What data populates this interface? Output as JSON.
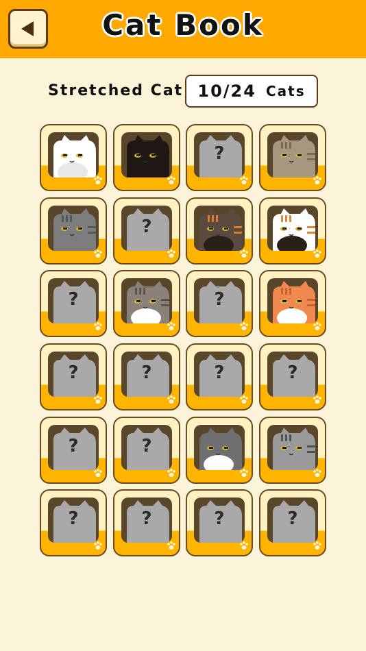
{
  "header": {
    "title": "Cat Book",
    "back_icon": "back-arrow-icon"
  },
  "collection": {
    "label": "Stretched Cat",
    "count": "10/24",
    "unit": "Cats"
  },
  "colors": {
    "header": "#ffa800",
    "background": "#fcf4d9",
    "card_bottom": "#ffb400",
    "card_top": "#fff2c2"
  },
  "cats": [
    {
      "unlocked": true,
      "fur": "white"
    },
    {
      "unlocked": true,
      "fur": "black"
    },
    {
      "unlocked": false,
      "label": "?"
    },
    {
      "unlocked": true,
      "fur": "brown-tabby"
    },
    {
      "unlocked": true,
      "fur": "gray-tabby"
    },
    {
      "unlocked": false,
      "label": "?"
    },
    {
      "unlocked": true,
      "fur": "tortoiseshell"
    },
    {
      "unlocked": true,
      "fur": "calico"
    },
    {
      "unlocked": false,
      "label": "?"
    },
    {
      "unlocked": true,
      "fur": "gray-white-tabby"
    },
    {
      "unlocked": false,
      "label": "?"
    },
    {
      "unlocked": true,
      "fur": "orange-tabby"
    },
    {
      "unlocked": false,
      "label": "?"
    },
    {
      "unlocked": false,
      "label": "?"
    },
    {
      "unlocked": false,
      "label": "?"
    },
    {
      "unlocked": false,
      "label": "?"
    },
    {
      "unlocked": false,
      "label": "?"
    },
    {
      "unlocked": false,
      "label": "?"
    },
    {
      "unlocked": true,
      "fur": "gray-white"
    },
    {
      "unlocked": true,
      "fur": "silver-tabby"
    },
    {
      "unlocked": false,
      "label": "?"
    },
    {
      "unlocked": false,
      "label": "?"
    },
    {
      "unlocked": false,
      "label": "?"
    },
    {
      "unlocked": false,
      "label": "?"
    }
  ]
}
